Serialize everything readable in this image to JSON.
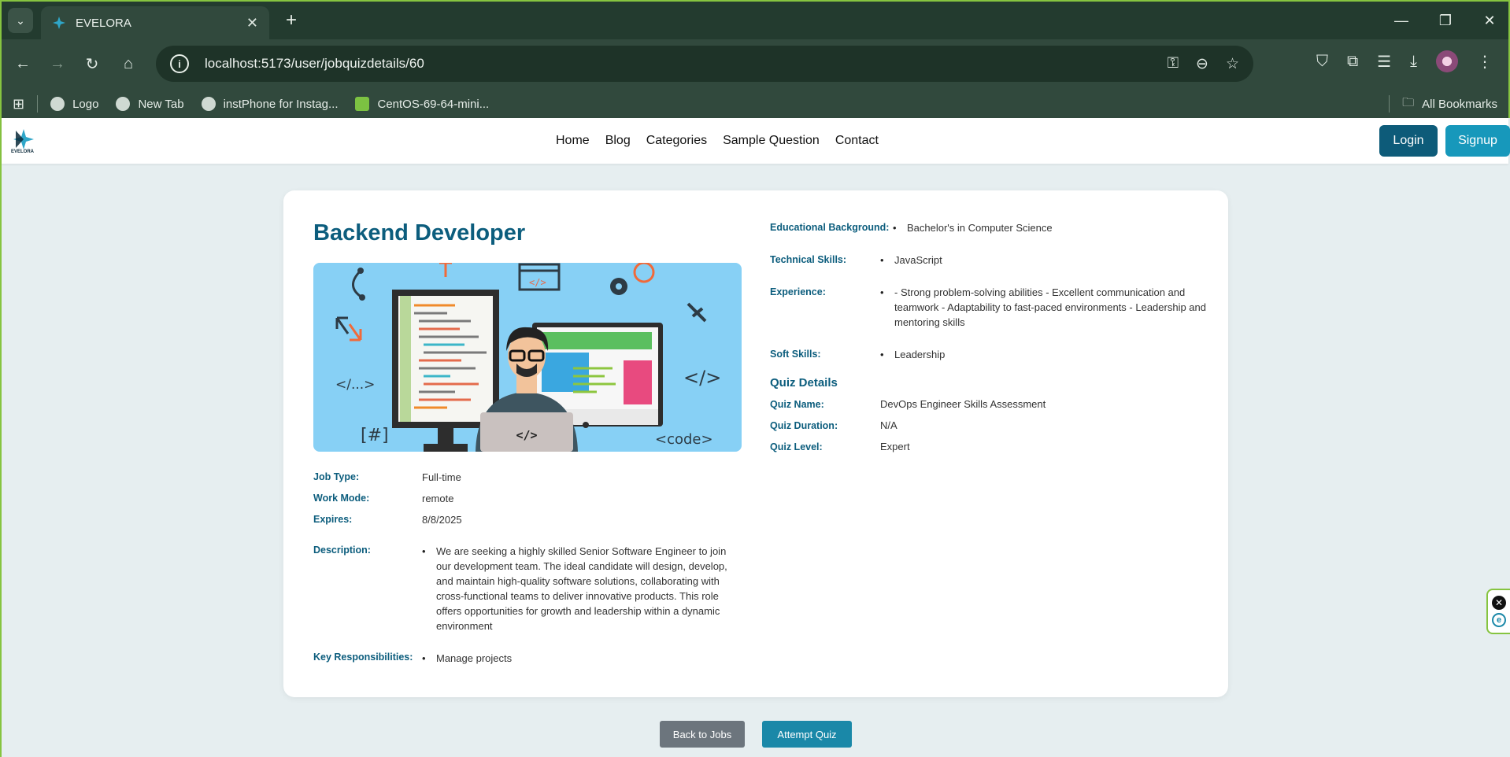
{
  "browser": {
    "tab_title": "EVELORA",
    "url": "localhost:5173/user/jobquizdetails/60",
    "bookmarks": [
      {
        "label": "Logo"
      },
      {
        "label": "New Tab"
      },
      {
        "label": "instPhone for Instag..."
      },
      {
        "label": "CentOS-69-64-mini..."
      }
    ],
    "all_bookmarks": "All Bookmarks"
  },
  "site": {
    "brand": "EVELORA",
    "nav": [
      "Home",
      "Blog",
      "Categories",
      "Sample Question",
      "Contact"
    ],
    "login": "Login",
    "signup": "Signup",
    "accent": "#0c5d7d"
  },
  "job": {
    "title": "Backend Developer",
    "image_labels": [
      "</...>",
      "</>",
      "[#]",
      "<code>",
      "</>",
      "</>"
    ],
    "job_type_label": "Job Type:",
    "job_type": "Full-time",
    "work_mode_label": "Work Mode:",
    "work_mode": "remote",
    "expires_label": "Expires:",
    "expires": "8/8/2025",
    "description_label": "Description:",
    "description": "We are seeking a highly skilled Senior Software Engineer to join our development team. The ideal candidate will design, develop, and maintain high-quality software solutions, collaborating with cross-functional teams to deliver innovative products. This role offers opportunities for growth and leadership within a dynamic environment",
    "responsibilities_label": "Key Responsibilities:",
    "responsibilities": "Manage projects",
    "education_label": "Educational Background:",
    "education": "Bachelor's in Computer Science",
    "skills_label": "Technical Skills:",
    "skills": "JavaScript",
    "experience_label": "Experience:",
    "experience": "- Strong problem-solving abilities - Excellent communication and teamwork - Adaptability to fast-paced environments - Leadership and mentoring skills",
    "soft_skills_label": "Soft Skills:",
    "soft_skills": "Leadership"
  },
  "quiz": {
    "heading": "Quiz Details",
    "name_label": "Quiz Name:",
    "name": "DevOps Engineer Skills Assessment",
    "duration_label": "Quiz Duration:",
    "duration": "N/A",
    "level_label": "Quiz Level:",
    "level": "Expert"
  },
  "actions": {
    "back": "Back to Jobs",
    "attempt": "Attempt Quiz"
  }
}
